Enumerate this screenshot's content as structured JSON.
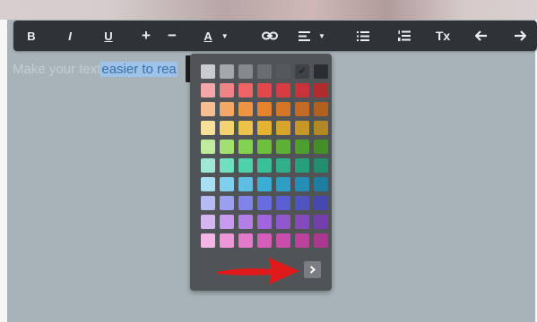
{
  "toolbar": {
    "bold": "B",
    "italic": "I",
    "underline": "U",
    "increase": "+",
    "decrease": "−",
    "font_color": "A",
    "clear_format": "Tx"
  },
  "editor": {
    "text_plain": "Make your text ",
    "text_selected": "easier to rea"
  },
  "palette": {
    "selected_color": "#3f4347",
    "colors": [
      "#c9cdd0",
      "#a4a8ab",
      "#868a8d",
      "#6a6e71",
      "#55595c",
      "#3f4347",
      "#2a2e31",
      "#f4a6a8",
      "#ef8386",
      "#ec6466",
      "#e4474b",
      "#d63c42",
      "#c73338",
      "#b32a2f",
      "#f6be93",
      "#f2a868",
      "#ee9444",
      "#e6822c",
      "#d57528",
      "#c46a27",
      "#b25f22",
      "#f7e19a",
      "#f2d36f",
      "#ecc248",
      "#e5b32e",
      "#d6a52a",
      "#c59728",
      "#b38824",
      "#bfeb9b",
      "#a1e071",
      "#84d34f",
      "#6ec03c",
      "#5db034",
      "#4f9f2e",
      "#448e29",
      "#9fe9d4",
      "#72dfbf",
      "#4fd2ab",
      "#39c197",
      "#30af88",
      "#289f7b",
      "#228e6e",
      "#a9dff3",
      "#7fd0ec",
      "#5bc0e3",
      "#3baed5",
      "#2f9ec5",
      "#268db4",
      "#1f7da2",
      "#b7bbf3",
      "#9a9ff0",
      "#7f83ea",
      "#676ce1",
      "#5a5fd2",
      "#5054c1",
      "#4648ae",
      "#d7b5f1",
      "#c69aec",
      "#b37ee5",
      "#a064dc",
      "#9256cd",
      "#8449bd",
      "#763eab",
      "#f4b6e3",
      "#ec97d7",
      "#e37ac9",
      "#d75dba",
      "#c94eac",
      "#b9429d",
      "#a9388e"
    ]
  }
}
